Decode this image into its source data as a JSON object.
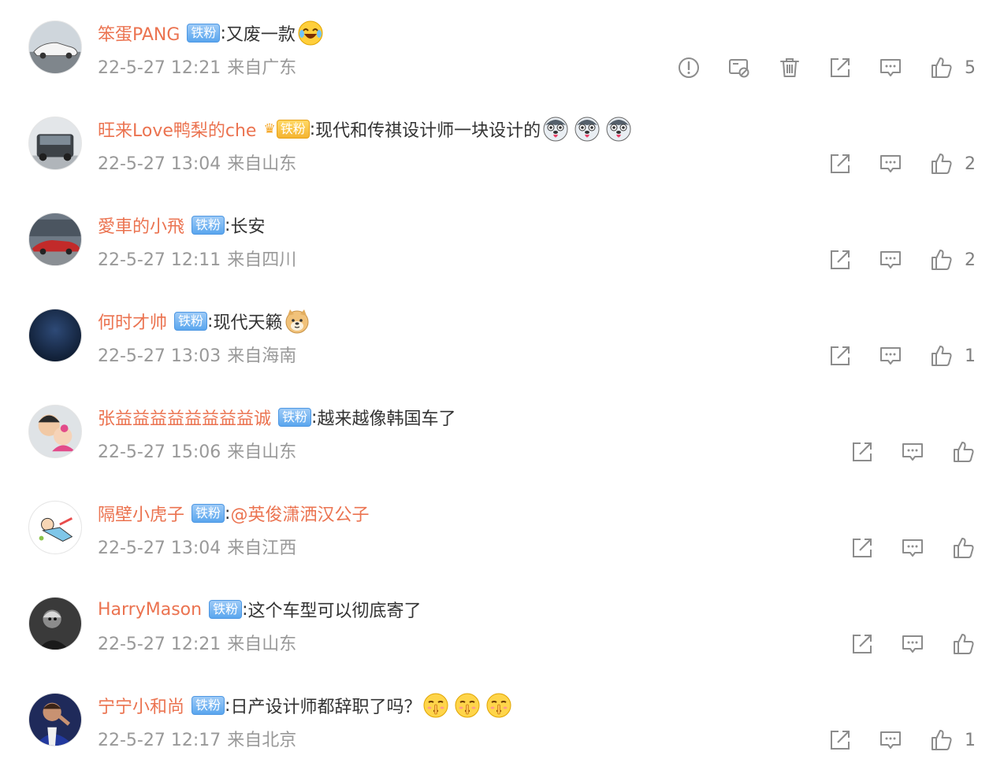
{
  "comments": [
    {
      "user": "笨蛋PANG",
      "badge": "铁粉",
      "badge_style": "blue",
      "has_crown": false,
      "text": "又废一款",
      "mention": "",
      "emojis": [
        "laugh-cry-emoji"
      ],
      "date": "22-5-27 12:21",
      "location": "来自广东",
      "likes": "5",
      "actions": [
        "report-icon",
        "hide-icon",
        "delete-icon",
        "share-icon",
        "reply-icon",
        "like-icon"
      ]
    },
    {
      "user": "旺来Love鸭梨的che",
      "badge": "铁粉",
      "badge_style": "gold",
      "has_crown": true,
      "text": "现代和传祺设计师一块设计的",
      "mention": "",
      "emojis": [
        "husky-emoji",
        "husky-emoji",
        "husky-emoji"
      ],
      "date": "22-5-27 13:04",
      "location": "来自山东",
      "likes": "2",
      "actions": [
        "share-icon",
        "reply-icon",
        "like-icon"
      ]
    },
    {
      "user": "愛車的小飛",
      "badge": "铁粉",
      "badge_style": "blue",
      "has_crown": false,
      "text": "长安",
      "mention": "",
      "emojis": [],
      "date": "22-5-27 12:11",
      "location": "来自四川",
      "likes": "2",
      "actions": [
        "share-icon",
        "reply-icon",
        "like-icon"
      ]
    },
    {
      "user": "何时才帅",
      "badge": "铁粉",
      "badge_style": "blue",
      "has_crown": false,
      "text": "现代天籁",
      "mention": "",
      "emojis": [
        "doge-emoji"
      ],
      "date": "22-5-27 13:03",
      "location": "来自海南",
      "likes": "1",
      "actions": [
        "share-icon",
        "reply-icon",
        "like-icon"
      ]
    },
    {
      "user": "张益益益益益益益益诚",
      "badge": "铁粉",
      "badge_style": "blue",
      "has_crown": false,
      "text": "越来越像韩国车了",
      "mention": "",
      "emojis": [],
      "date": "22-5-27 15:06",
      "location": "来自山东",
      "likes": "",
      "actions": [
        "share-icon",
        "reply-icon",
        "like-icon"
      ]
    },
    {
      "user": "隔壁小虎子",
      "badge": "铁粉",
      "badge_style": "blue",
      "has_crown": false,
      "text": "",
      "mention": "@英俊潇洒汉公子",
      "emojis": [],
      "date": "22-5-27 13:04",
      "location": "来自江西",
      "likes": "",
      "actions": [
        "share-icon",
        "reply-icon",
        "like-icon"
      ]
    },
    {
      "user": "HarryMason",
      "badge": "铁粉",
      "badge_style": "blue",
      "has_crown": false,
      "text": "这个车型可以彻底寄了",
      "mention": "",
      "emojis": [],
      "date": "22-5-27 12:21",
      "location": "来自山东",
      "likes": "",
      "actions": [
        "share-icon",
        "reply-icon",
        "like-icon"
      ]
    },
    {
      "user": "宁宁小和尚",
      "badge": "铁粉",
      "badge_style": "blue",
      "has_crown": false,
      "text": "日产设计师都辞职了吗？",
      "mention": "",
      "emojis": [
        "shush-emoji",
        "shush-emoji",
        "shush-emoji"
      ],
      "date": "22-5-27 12:17",
      "location": "来自北京",
      "likes": "1",
      "actions": [
        "share-icon",
        "reply-icon",
        "like-icon"
      ]
    }
  ],
  "separator": ":",
  "colors": {
    "username": "#eb7350",
    "meta": "#999999",
    "badge_blue": "#5aa6ee",
    "badge_gold": "#f4b431",
    "icon": "#8c8c8c"
  }
}
